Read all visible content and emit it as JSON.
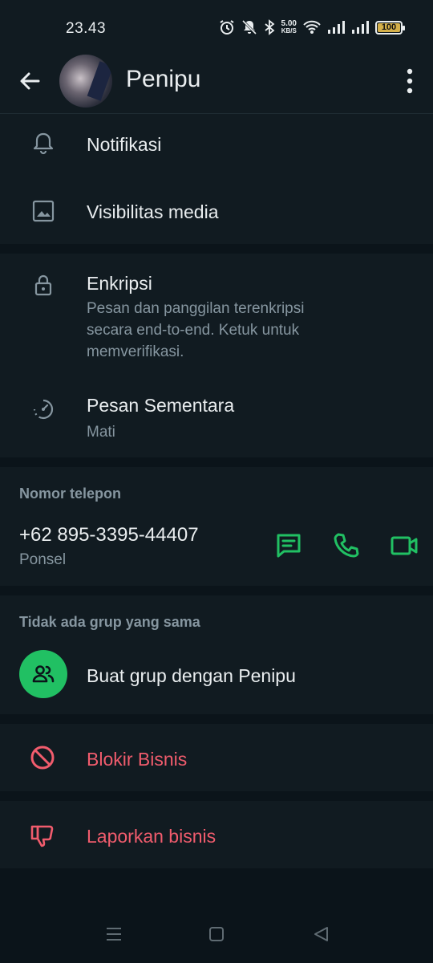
{
  "status": {
    "time": "23.43",
    "net_speed_value": "5.00",
    "net_speed_unit": "KB/S",
    "battery": "100"
  },
  "header": {
    "contact_name": "Penipu"
  },
  "settings": {
    "notifications": "Notifikasi",
    "media_visibility": "Visibilitas media"
  },
  "security": {
    "encryption_title": "Enkripsi",
    "encryption_desc_1": "Pesan dan panggilan terenkripsi",
    "encryption_desc_2": "secara end-to-end. Ketuk untuk",
    "encryption_desc_3": "memverifikasi.",
    "disappearing_title": "Pesan Sementara",
    "disappearing_value": "Mati"
  },
  "phone": {
    "label": "Nomor telepon",
    "number": "+62 895-3395-44407",
    "type": "Ponsel"
  },
  "groups": {
    "label": "Tidak ada grup yang sama",
    "create_group": "Buat grup dengan Penipu"
  },
  "actions": {
    "block": "Blokir Bisnis",
    "report": "Laporkan bisnis"
  },
  "colors": {
    "accent_green": "#21c063",
    "danger_red": "#f15c6d"
  }
}
